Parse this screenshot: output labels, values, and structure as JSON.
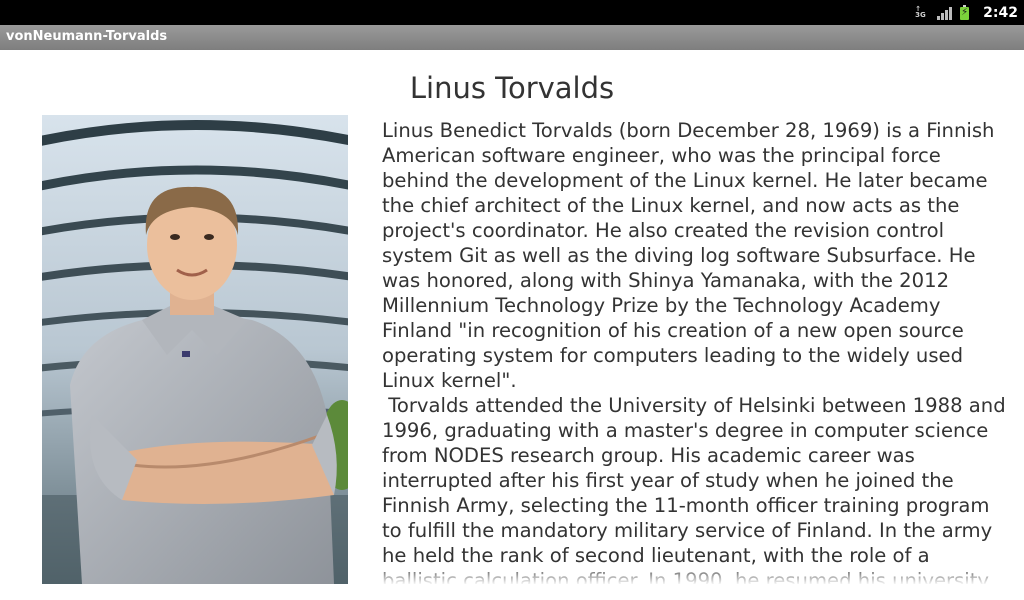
{
  "status_bar": {
    "time": "2:42",
    "icons": [
      "3g-data-icon",
      "signal-strength-icon",
      "battery-charging-icon"
    ],
    "network_label": "3G"
  },
  "app": {
    "title": "vonNeumann-Torvalds"
  },
  "article": {
    "title": "Linus Torvalds",
    "portrait": "portrait-photo",
    "paragraphs": [
      "Linus Benedict Torvalds (born December 28, 1969) is a Finnish American software engineer, who was the principal force behind the development of the Linux kernel. He later became the chief architect of the Linux kernel, and now acts as the project's coordinator. He also created the revision control system Git as well as the diving log software Subsurface. He was honored, along with Shinya Yamanaka, with the 2012 Millennium Technology Prize by the Technology Academy Finland \"in recognition of his creation of a new open source operating system for computers leading to the widely used Linux kernel\".",
      " Torvalds attended the University of Helsinki between 1988 and 1996, graduating with a master's degree in computer science from NODES research group. His academic career was interrupted after his first year of study when he joined the Finnish Army, selecting the 11-month officer training program to fulfill the mandatory military service of Finland. In the army he held the rank of second lieutenant, with the role of a ballistic calculation officer. In 1990, he resumed his university"
    ]
  },
  "colors": {
    "status_bar": "#000000",
    "title_bar": "#8a8a8a",
    "text": "#333333",
    "background": "#ffffff"
  }
}
